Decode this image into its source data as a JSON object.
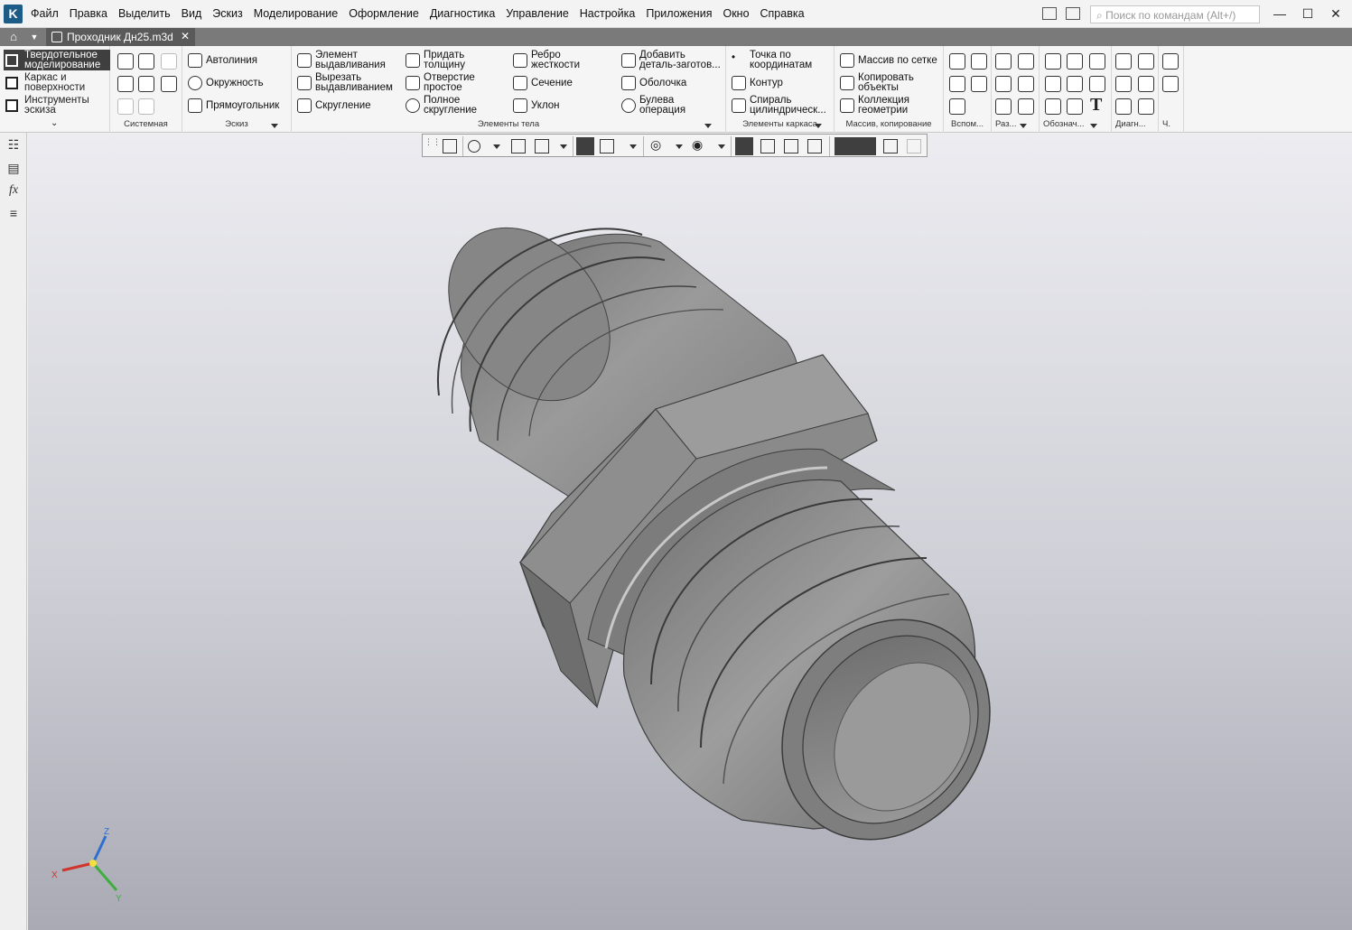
{
  "menubar": {
    "logo": "K",
    "items": [
      "Файл",
      "Правка",
      "Выделить",
      "Вид",
      "Эскиз",
      "Моделирование",
      "Оформление",
      "Диагностика",
      "Управление",
      "Настройка",
      "Приложения",
      "Окно",
      "Справка"
    ],
    "search_placeholder": "Поиск по командам (Alt+/)",
    "minimize": "—",
    "maximize": "☐",
    "close": "✕"
  },
  "tabbar": {
    "home_icon": "home-icon",
    "doc_tab": "Проходник Дн25.m3d",
    "doc_close": "✕"
  },
  "ribbon": {
    "modes": [
      "Твердотельное моделирование",
      "Каркас и поверхности",
      "Инструменты эскиза"
    ],
    "modes_split": [
      [
        "Твердотельное",
        "моделирование"
      ],
      [
        "Каркас и",
        "поверхности"
      ],
      [
        "Инструменты",
        "эскиза"
      ]
    ],
    "groups": {
      "system": "Системная",
      "sketch": "Эскиз",
      "body": "Элементы тела",
      "frame": "Элементы каркаса",
      "array": "Массив, копирование",
      "aux": "Вспом...",
      "dim": "Раз...",
      "annot": "Обознач...",
      "diag": "Диагн...",
      "ch": "Ч."
    },
    "sketch_buttons": [
      "Автолиния",
      "Окружность",
      "Прямоугольник"
    ],
    "body_buttons": {
      "extrude": [
        "Элемент",
        "выдавливания"
      ],
      "cut": [
        "Вырезать",
        "выдавливанием"
      ],
      "fillet": "Скругление",
      "thicken": [
        "Придать",
        "толщину"
      ],
      "hole": [
        "Отверстие",
        "простое"
      ],
      "full_fillet": [
        "Полное",
        "скругление"
      ],
      "rib": [
        "Ребро",
        "жесткости"
      ],
      "section": "Сечение",
      "draft": "Уклон",
      "add_part": [
        "Добавить",
        "деталь-заготов..."
      ],
      "shell": "Оболочка",
      "boolean": [
        "Булева",
        "операция"
      ]
    },
    "frame_buttons": {
      "point": [
        "Точка по",
        "координатам"
      ],
      "contour": "Контур",
      "spiral": [
        "Спираль",
        "цилиндрическ..."
      ]
    },
    "array_buttons": {
      "grid": "Массив по сетке",
      "copy": [
        "Копировать",
        "объекты"
      ],
      "collection": [
        "Коллекция",
        "геометрии"
      ]
    },
    "text_glyph": "T"
  },
  "leftpanel": {
    "fx": "fx"
  },
  "axes": {
    "x": "X",
    "y": "Y",
    "z": "Z"
  },
  "colors": {
    "active_mode": "#3f3f3f",
    "axis_x": "#d0342c",
    "axis_y": "#3fae3f",
    "axis_z": "#2f6fd0",
    "part": "#8c8c8c"
  }
}
